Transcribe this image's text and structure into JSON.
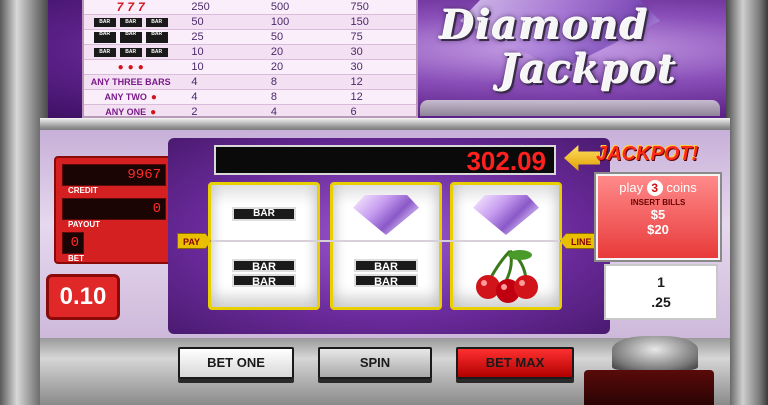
{
  "paytable": {
    "rows": [
      {
        "symbol_type": "sevens",
        "values": [
          "250",
          "500",
          "750"
        ]
      },
      {
        "symbol_type": "triple-bars",
        "values": [
          "50",
          "100",
          "150"
        ]
      },
      {
        "symbol_type": "double-bars",
        "values": [
          "25",
          "50",
          "75"
        ]
      },
      {
        "symbol_type": "single-bars",
        "values": [
          "10",
          "20",
          "30"
        ]
      },
      {
        "symbol_type": "cherries",
        "values": [
          "10",
          "20",
          "30"
        ]
      },
      {
        "symbol_type": "text",
        "label": "ANY THREE BARS",
        "values": [
          "4",
          "8",
          "12"
        ]
      },
      {
        "symbol_type": "text-cherry",
        "label": "ANY TWO",
        "values": [
          "4",
          "8",
          "12"
        ]
      },
      {
        "symbol_type": "text-cherry",
        "label": "ANY ONE",
        "values": [
          "2",
          "4",
          "6"
        ]
      }
    ],
    "bar_text": "BAR"
  },
  "logo": {
    "line1": "Diamond",
    "line2": "Jackpot"
  },
  "counters": {
    "credit_value": "9967",
    "credit_label": "CREDIT",
    "payout_value": "0",
    "payout_label": "PAYOUT",
    "bet_value": "0",
    "bet_label": "BET"
  },
  "denomination": "0.10",
  "jackpot": {
    "value": "302.09",
    "label": "JACKPOT!"
  },
  "reels": {
    "bar_text": "BAR",
    "reel1": [
      "single-bar",
      "double-bar"
    ],
    "reel2": [
      "diamond",
      "double-bar"
    ],
    "reel3": [
      "diamond",
      "cherries"
    ]
  },
  "payline": {
    "left": "PAY",
    "right": "LINE"
  },
  "coins_panel": {
    "play_prefix": "play",
    "play_count": "3",
    "play_suffix": "coins",
    "insert_label": "INSERT BILLS",
    "amount1": "$5",
    "amount2": "$20"
  },
  "paybox": {
    "line1": "1",
    "line2": ".25"
  },
  "buttons": {
    "bet_one": "BET ONE",
    "spin": "SPIN",
    "bet_max": "BET MAX"
  },
  "colors": {
    "accent_red": "#ff2020",
    "reel_border": "#e8d000",
    "cabinet_purple": "#6a2a9a"
  }
}
